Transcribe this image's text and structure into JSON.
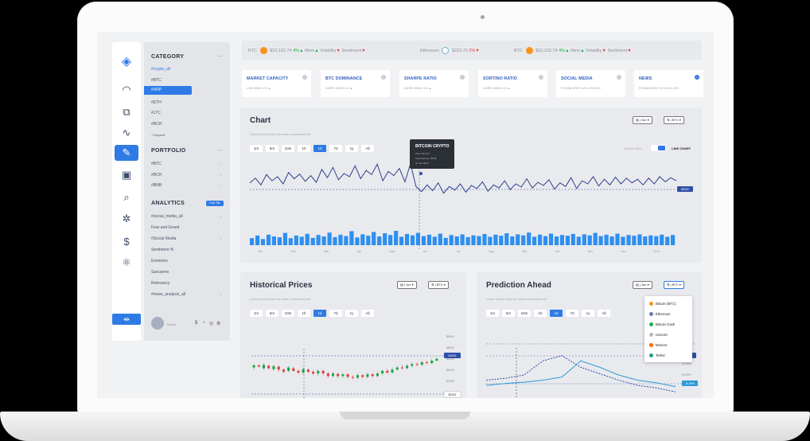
{
  "sidebar": {
    "bottom_icon": "collapse-icon",
    "icons": [
      "logo-cube-icon",
      "speedometer-icon",
      "network-icon",
      "trend-icon",
      "analytics-chart-icon",
      "excel-report-icon",
      "search-report-icon",
      "settings-gear-icon",
      "dollar-circle-icon",
      "atom-icon"
    ]
  },
  "category": {
    "title": "CATEGORY",
    "collapse": "—",
    "items": [
      "#crypto_all",
      "#BTC",
      "#XRP",
      "#ETH",
      "#LTC",
      "#BCH"
    ],
    "expand": "Expand",
    "portfolio_title": "PORTFOLIO",
    "portfolio_items": [
      "#BTC",
      "#BCH",
      "#BNB"
    ],
    "analytics_title": "ANALYTICS",
    "analytics_badge": "Fast Tile",
    "analytics_items": [
      "#social_media_all",
      "Fear and Greed",
      "#Social Media",
      "Sentiment %",
      "Emotions",
      "Sarcasms",
      "Relevancy",
      "#news_analysis_all"
    ],
    "user_name": "Rhyse",
    "user_icons": [
      "$",
      "◔",
      "◎",
      "⚙"
    ]
  },
  "ticker": [
    {
      "sym": "BTC",
      "price": "$10,102.74",
      "pct": "4%",
      "dir": "up",
      "label1": "Mem",
      "label2": "Volatility",
      "label3": "Sentiment"
    },
    {
      "sym": "Ethereum",
      "price": "$222.75",
      "pct": "2%",
      "dir": "dn"
    },
    {
      "sym": "BTC",
      "price": "$10,102.74",
      "pct": "4%",
      "dir": "up",
      "label1": "Mem",
      "label2": "Volatility",
      "label3": "Sentiment"
    }
  ],
  "kpis": [
    {
      "title": "MARKET CAPACITY",
      "sub": "USD          300$       2.1%  ▲"
    },
    {
      "title": "BTC DOMINANCE",
      "sub": "24HRS          300$       2.1%  ▲"
    },
    {
      "title": "SHARPE RATIO",
      "sub": "24HRS          300$       2.1%  ▲"
    },
    {
      "title": "SORTINO RATIO",
      "sub": "24HRS          300$       2.1%  ▲"
    },
    {
      "title": "SOCIAL MEDIA",
      "sub": "POS/NEG/REG        10%   10%  30%"
    },
    {
      "title": "NEWS",
      "sub": "POS/NEG/REG        30%   40%  10%"
    }
  ],
  "chart_panel": {
    "title": "Chart",
    "subtitle": "Lorem ipsum dolor sit amet consectetur elit",
    "timeframes": [
      "1m",
      "5m",
      "10m",
      "1h",
      "1d",
      "7d",
      "1y",
      "All"
    ],
    "active_tf": "1d",
    "select_period": "Jun",
    "select_asset": "BTC",
    "toggle_left": "Candle Stick",
    "toggle_right": "LINE CHART",
    "tooltip_title": "BITCOIN CRYPTO",
    "tooltip_lines": [
      "Price: $7,274",
      "Total Volume: 357M",
      "31 Jan 2019"
    ],
    "price_tag": "$9000"
  },
  "historical_panel": {
    "title": "Historical Prices",
    "subtitle": "Lorem ipsum dolor sit amet consectetur elit",
    "timeframes": [
      "1m",
      "5m",
      "10m",
      "1h",
      "1d",
      "7d",
      "1y",
      "All"
    ],
    "active_tf": "1d",
    "select_period": "Jun",
    "select_asset": "BTC",
    "yticks": [
      "$9000",
      "$8000",
      "$5000",
      "$6000",
      "$2000"
    ],
    "price_tag": "$4000",
    "bottom_tag": "$1400"
  },
  "prediction_panel": {
    "title": "Prediction Ahead",
    "subtitle": "Lorem ipsum dolor sit amet consectetur elit",
    "timeframes": [
      "1m",
      "5m",
      "10m",
      "1h",
      "1d",
      "7d",
      "1y",
      "All"
    ],
    "active_tf": "1d",
    "select_period": "Jun",
    "select_asset": "BTC",
    "yticks": [
      "20.00%",
      "30.00%"
    ],
    "tag1": "%",
    "tag2": "10.00%",
    "dropdown": [
      {
        "name": "Bitcoin (BTC)",
        "color": "#f7931a"
      },
      {
        "name": "Ethereum",
        "color": "#6c7aa8"
      },
      {
        "name": "Bitcoin Cash",
        "color": "#1bb24a"
      },
      {
        "name": "Litecoin",
        "color": "#b8b8b8"
      },
      {
        "name": "Monero",
        "color": "#ff6600"
      },
      {
        "name": "Tether",
        "color": "#26a17b"
      }
    ]
  },
  "chart_data": [
    {
      "type": "line",
      "title": "Chart",
      "x": [
        "Jan",
        "Feb",
        "Mar",
        "Apr",
        "May",
        "Jun",
        "Jul",
        "Aug",
        "Sep",
        "Oct",
        "Nov",
        "Dec",
        "2019"
      ],
      "series": [
        {
          "values": [
            62,
            71,
            58,
            78,
            66,
            74,
            60,
            82,
            70,
            79,
            65,
            76,
            63,
            88,
            72,
            92,
            68,
            80,
            74,
            95,
            70,
            86,
            78,
            98,
            66,
            84,
            76,
            90,
            64,
            99,
            55,
            45,
            58,
            47,
            62,
            42,
            55,
            48,
            60,
            44,
            57,
            51,
            64,
            46,
            58,
            52,
            66,
            49,
            60,
            54,
            70,
            52,
            63,
            57,
            68,
            50,
            62,
            55,
            72,
            51,
            66,
            60,
            74,
            56,
            69,
            58,
            73,
            60,
            71,
            62,
            69,
            58,
            71,
            60,
            74,
            64,
            72,
            66
          ]
        }
      ],
      "volume": [
        40,
        55,
        35,
        60,
        50,
        45,
        70,
        40,
        55,
        48,
        65,
        42,
        58,
        50,
        72,
        46,
        60,
        52,
        80,
        44,
        62,
        54,
        75,
        50,
        68,
        58,
        82,
        48,
        64,
        56,
        70,
        52,
        60,
        48,
        66,
        42,
        58,
        50,
        62,
        46,
        56,
        52,
        64,
        48,
        60,
        54,
        68,
        50,
        62,
        56,
        72,
        48,
        60,
        52,
        66,
        50,
        58,
        54,
        64,
        48,
        62,
        56,
        70,
        52,
        60,
        50,
        66,
        48,
        58,
        54,
        62,
        50,
        56,
        52,
        60,
        48,
        58
      ]
    },
    {
      "type": "candlestick",
      "title": "Historical Prices",
      "candles": [
        [
          60,
          65,
          55,
          68,
          "g"
        ],
        [
          65,
          62,
          60,
          68,
          "r"
        ],
        [
          58,
          66,
          55,
          70,
          "g"
        ],
        [
          64,
          58,
          55,
          67,
          "r"
        ],
        [
          56,
          63,
          52,
          66,
          "g"
        ],
        [
          62,
          55,
          50,
          64,
          "r"
        ],
        [
          55,
          50,
          46,
          58,
          "r"
        ],
        [
          52,
          60,
          48,
          64,
          "g"
        ],
        [
          58,
          52,
          50,
          62,
          "r"
        ],
        [
          52,
          48,
          44,
          56,
          "r"
        ],
        [
          48,
          56,
          45,
          60,
          "g"
        ],
        [
          55,
          50,
          46,
          58,
          "r"
        ],
        [
          50,
          46,
          42,
          54,
          "r"
        ],
        [
          46,
          52,
          40,
          56,
          "g"
        ],
        [
          52,
          46,
          42,
          55,
          "r"
        ],
        [
          46,
          40,
          36,
          50,
          "r"
        ],
        [
          40,
          46,
          36,
          50,
          "g"
        ],
        [
          45,
          40,
          35,
          48,
          "r"
        ],
        [
          40,
          44,
          36,
          48,
          "g"
        ],
        [
          44,
          38,
          34,
          46,
          "r"
        ],
        [
          38,
          36,
          32,
          42,
          "r"
        ],
        [
          36,
          42,
          32,
          46,
          "g"
        ],
        [
          42,
          38,
          34,
          44,
          "r"
        ],
        [
          38,
          44,
          35,
          48,
          "g"
        ],
        [
          44,
          40,
          36,
          47,
          "r"
        ],
        [
          40,
          46,
          37,
          50,
          "g"
        ],
        [
          46,
          52,
          42,
          55,
          "g"
        ],
        [
          52,
          48,
          46,
          57,
          "r"
        ],
        [
          48,
          55,
          46,
          60,
          "g"
        ],
        [
          55,
          60,
          52,
          64,
          "g"
        ],
        [
          60,
          58,
          55,
          66,
          "r"
        ],
        [
          58,
          64,
          56,
          68,
          "g"
        ],
        [
          64,
          68,
          60,
          72,
          "g"
        ],
        [
          68,
          66,
          63,
          72,
          "r"
        ],
        [
          66,
          72,
          64,
          75,
          "g"
        ],
        [
          72,
          70,
          68,
          76,
          "r"
        ],
        [
          70,
          76,
          68,
          80,
          "g"
        ],
        [
          76,
          80,
          74,
          84,
          "g"
        ]
      ]
    },
    {
      "type": "line",
      "title": "Prediction Ahead",
      "series": [
        {
          "values": [
            30,
            33,
            38,
            60,
            68,
            50,
            40,
            30,
            22,
            18,
            12
          ]
        },
        {
          "values": [
            22,
            25,
            27,
            30,
            35,
            60,
            50,
            38,
            30,
            26,
            20
          ]
        }
      ]
    }
  ]
}
